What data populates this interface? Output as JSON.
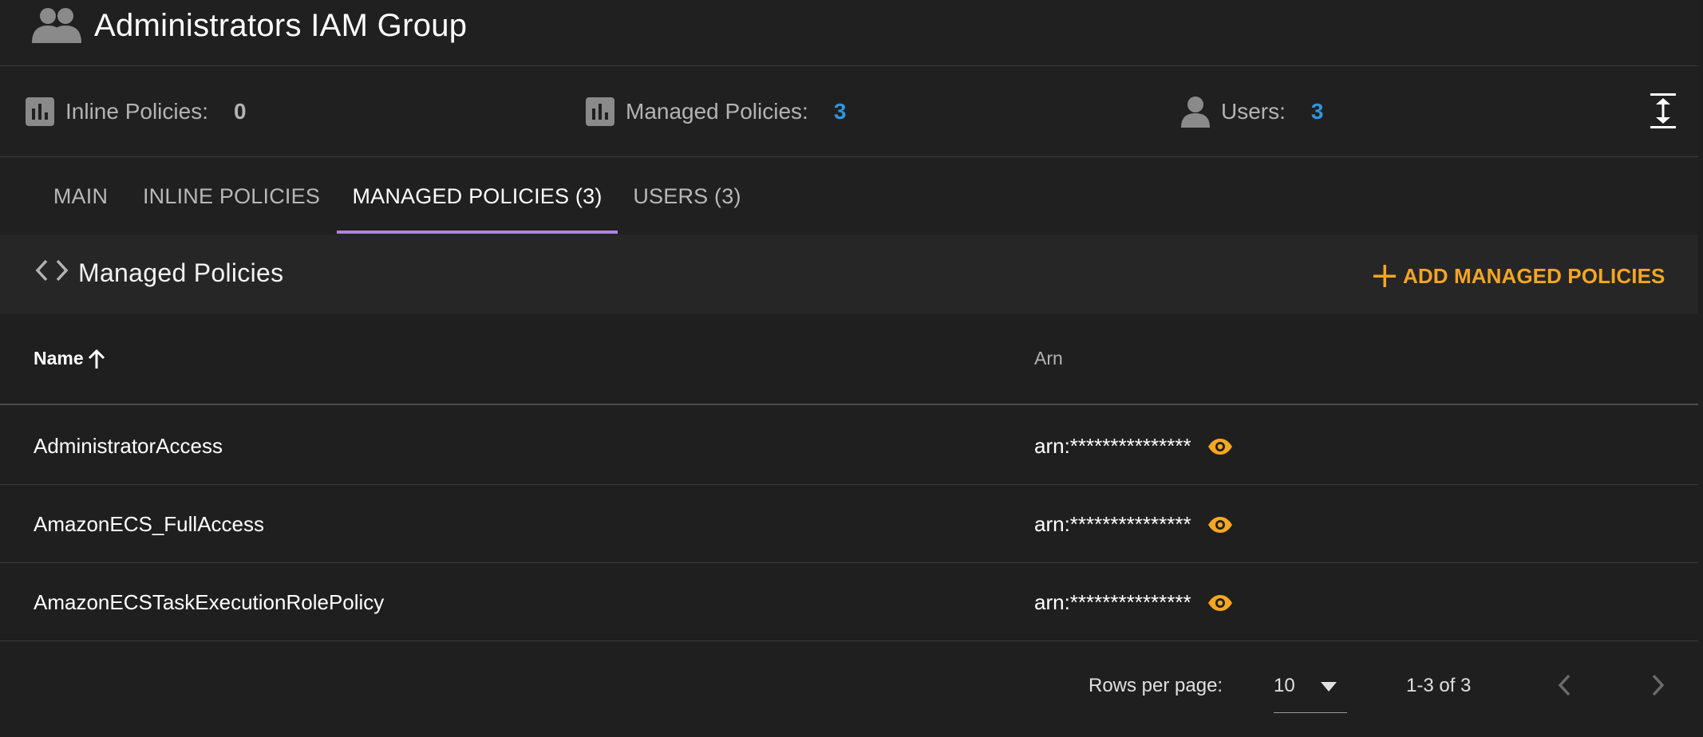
{
  "header": {
    "title": "Administrators IAM Group",
    "icon": "users-group-icon"
  },
  "stats": [
    {
      "label": "Inline Policies:",
      "value": "0",
      "icon": "bar-chart-icon"
    },
    {
      "label": "Managed Policies:",
      "value": "3",
      "icon": "bar-chart-icon"
    },
    {
      "label": "Users:",
      "value": "3",
      "icon": "person-icon"
    }
  ],
  "tabs": [
    {
      "label": "MAIN"
    },
    {
      "label": "INLINE POLICIES"
    },
    {
      "label": "MANAGED POLICIES (3)",
      "active": true
    },
    {
      "label": "USERS (3)"
    }
  ],
  "section": {
    "title": "Managed Policies",
    "add_label": "ADD MANAGED POLICIES"
  },
  "table": {
    "columns": {
      "name": "Name",
      "arn": "Arn"
    },
    "rows": [
      {
        "name": "AdministratorAccess",
        "arn": "arn:***************"
      },
      {
        "name": "AmazonECS_FullAccess",
        "arn": "arn:***************"
      },
      {
        "name": "AmazonECSTaskExecutionRolePolicy",
        "arn": "arn:***************"
      }
    ]
  },
  "pagination": {
    "rows_per_page_label": "Rows per page:",
    "rows_per_page": "10",
    "range": "1-3 of 3"
  },
  "colors": {
    "accent": "#f5a623",
    "tab_indicator": "#b084e6",
    "link_blue": "#2f95e0",
    "background": "#1f1f1f"
  }
}
